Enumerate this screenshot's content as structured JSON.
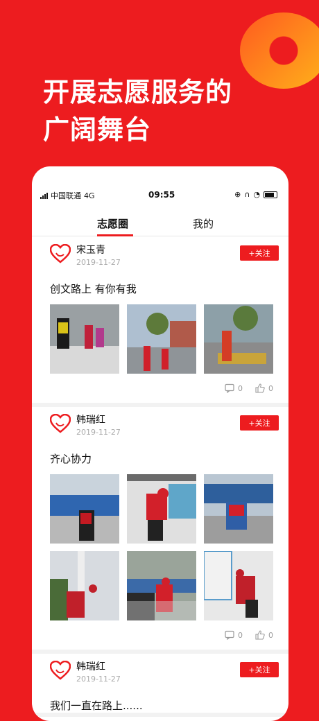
{
  "banner": {
    "headline_line1": "开展志愿服务的",
    "headline_line2": "广阔舞台"
  },
  "status_bar": {
    "carrier": "中国联通",
    "network": "4G",
    "time": "09:55"
  },
  "tabs": [
    {
      "label": "志愿圈"
    },
    {
      "label": "我的"
    }
  ],
  "posts": [
    {
      "name": "宋玉青",
      "date": "2019-11-27",
      "follow_label": "+关注",
      "text": "创文路上  有你有我",
      "comments": "0",
      "likes": "0"
    },
    {
      "name": "韩瑞红",
      "date": "2019-11-27",
      "follow_label": "+关注",
      "text": "齐心协力",
      "comments": "0",
      "likes": "0"
    },
    {
      "name": "韩瑞红",
      "date": "2019-11-27",
      "follow_label": "+关注",
      "text": "我们一直在路上......"
    }
  ],
  "colors": {
    "accent": "#ed1c1f",
    "deco_orange": "#ff8a1f",
    "muted": "#aaaaaa"
  }
}
